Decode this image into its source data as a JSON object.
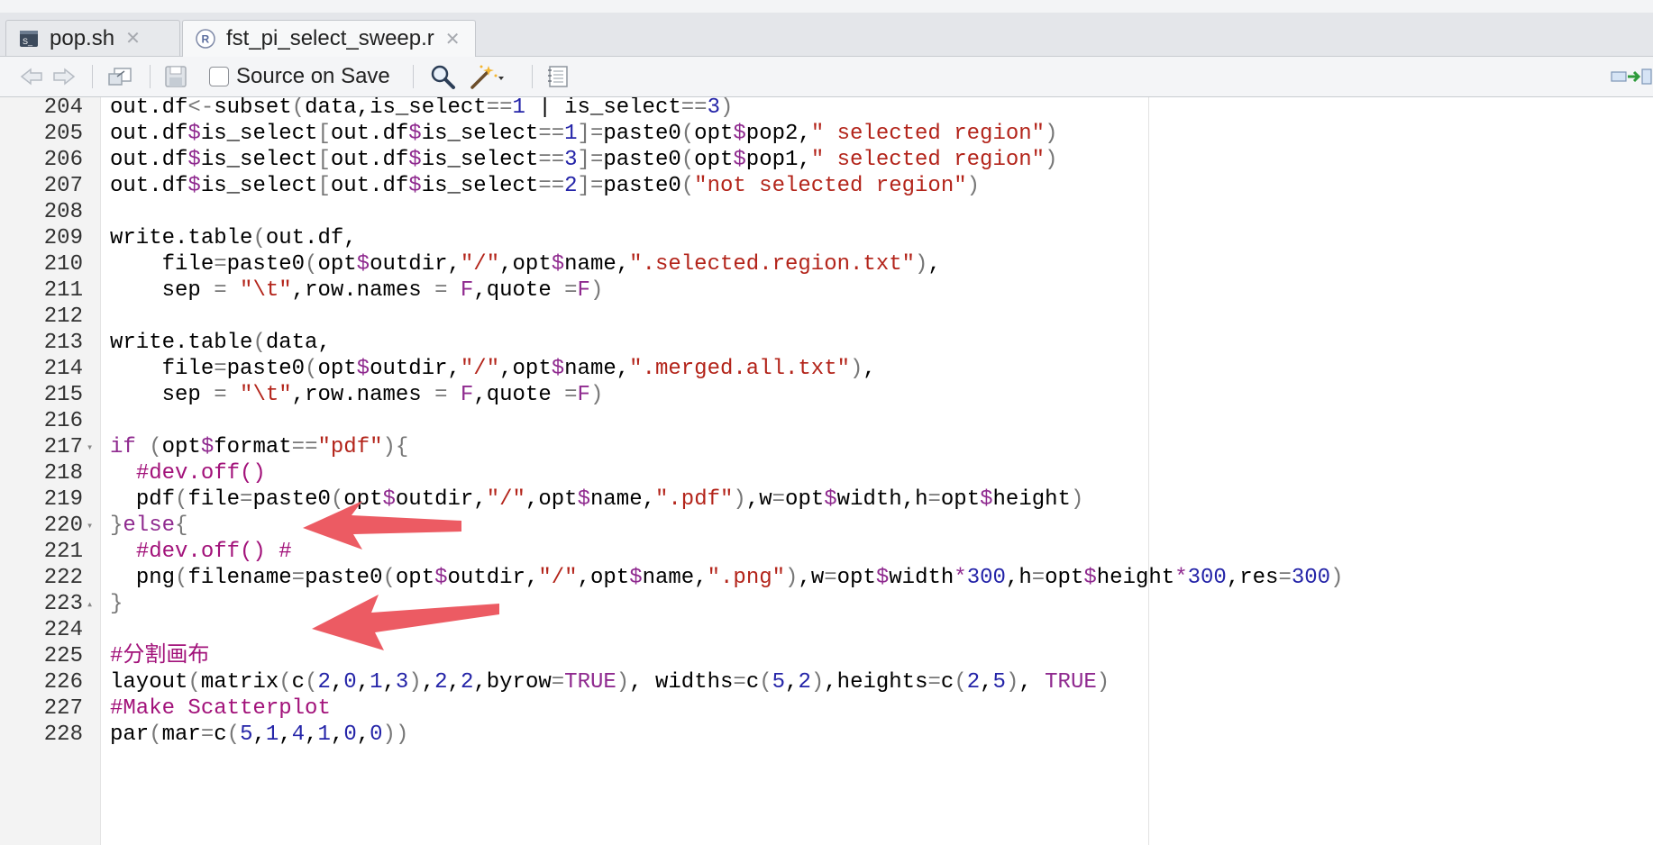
{
  "tabs": [
    {
      "label": "pop.sh",
      "icon": "shell-script-icon",
      "active": false
    },
    {
      "label": "fst_pi_select_sweep.r",
      "icon": "r-file-icon",
      "active": true
    }
  ],
  "toolbar": {
    "source_on_save_label": "Source on Save"
  },
  "editor": {
    "lines": [
      {
        "num": "204",
        "fold": "",
        "text": "out.df<-subset(data,is_select==1 | is_select==3)"
      },
      {
        "num": "205",
        "fold": "",
        "text": "out.df$is_select[out.df$is_select==1]=paste0(opt$pop2,\" selected region\")"
      },
      {
        "num": "206",
        "fold": "",
        "text": "out.df$is_select[out.df$is_select==3]=paste0(opt$pop1,\" selected region\")"
      },
      {
        "num": "207",
        "fold": "",
        "text": "out.df$is_select[out.df$is_select==2]=paste0(\"not selected region\")"
      },
      {
        "num": "208",
        "fold": "",
        "text": ""
      },
      {
        "num": "209",
        "fold": "",
        "text": "write.table(out.df,"
      },
      {
        "num": "210",
        "fold": "",
        "text": "    file=paste0(opt$outdir,\"/\",opt$name,\".selected.region.txt\"),"
      },
      {
        "num": "211",
        "fold": "",
        "text": "    sep = \"\\t\",row.names = F,quote =F)"
      },
      {
        "num": "212",
        "fold": "",
        "text": ""
      },
      {
        "num": "213",
        "fold": "",
        "text": "write.table(data,"
      },
      {
        "num": "214",
        "fold": "",
        "text": "    file=paste0(opt$outdir,\"/\",opt$name,\".merged.all.txt\"),"
      },
      {
        "num": "215",
        "fold": "",
        "text": "    sep = \"\\t\",row.names = F,quote =F)"
      },
      {
        "num": "216",
        "fold": "",
        "text": ""
      },
      {
        "num": "217",
        "fold": "▾",
        "text": "if (opt$format==\"pdf\"){"
      },
      {
        "num": "218",
        "fold": "",
        "text": "  #dev.off()"
      },
      {
        "num": "219",
        "fold": "",
        "text": "  pdf(file=paste0(opt$outdir,\"/\",opt$name,\".pdf\"),w=opt$width,h=opt$height)"
      },
      {
        "num": "220",
        "fold": "▾",
        "text": "}else{"
      },
      {
        "num": "221",
        "fold": "",
        "text": "  #dev.off() #"
      },
      {
        "num": "222",
        "fold": "",
        "text": "  png(filename=paste0(opt$outdir,\"/\",opt$name,\".png\"),w=opt$width*300,h=opt$height*300,res=300)"
      },
      {
        "num": "223",
        "fold": "▴",
        "text": "}"
      },
      {
        "num": "224",
        "fold": "",
        "text": ""
      },
      {
        "num": "225",
        "fold": "",
        "text": "#分割画布"
      },
      {
        "num": "226",
        "fold": "",
        "text": "layout(matrix(c(2,0,1,3),2,2,byrow=TRUE), widths=c(5,2),heights=c(2,5), TRUE)"
      },
      {
        "num": "227",
        "fold": "",
        "text": "#Make Scatterplot"
      },
      {
        "num": "228",
        "fold": "",
        "text": "par(mar=c(5,1,4,1,0,0))"
      }
    ]
  },
  "colors": {
    "keyword": "#8f2a8f",
    "string": "#b3241a",
    "number": "#2424a8",
    "comment": "#a2127a",
    "operator": "#777777",
    "arrow": "#ec5b63"
  }
}
